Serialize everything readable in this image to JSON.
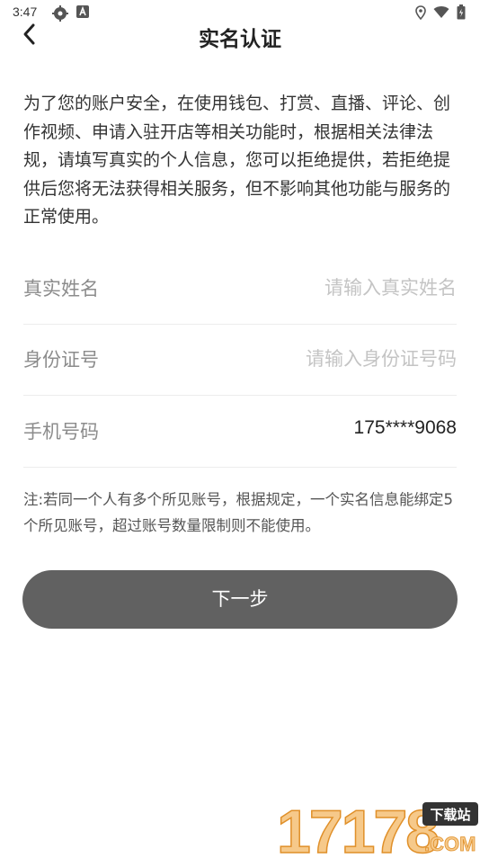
{
  "status_bar": {
    "time": "3:47",
    "left_icons": [
      "settings-gear-icon",
      "a-badge-icon"
    ],
    "right_icons": [
      "location-icon",
      "wifi-icon",
      "battery-icon"
    ]
  },
  "nav": {
    "back_icon": "back-chevron-icon",
    "title": "实名认证"
  },
  "intro": "为了您的账户安全，在使用钱包、打赏、直播、评论、创作视频、申请入驻开店等相关功能时，根据相关法律法规，请填写真实的个人信息，您可以拒绝提供，若拒绝提供后您将无法获得相关服务，但不影响其他功能与服务的正常使用。",
  "form": {
    "name": {
      "label": "真实姓名",
      "value": "",
      "placeholder": "请输入真实姓名"
    },
    "id_number": {
      "label": "身份证号",
      "value": "",
      "placeholder": "请输入身份证号码"
    },
    "phone": {
      "label": "手机号码",
      "value": "175****9068"
    }
  },
  "note": "注:若同一个人有多个所见账号，根据规定，一个实名信息能绑定5个所见账号，超过账号数量限制则不能使用。",
  "next_button": "下一步",
  "watermark": {
    "number": "17178",
    "tag": "下载站",
    "domain": ".COM"
  },
  "colors": {
    "button_bg": "#616161",
    "label": "#8c8c8c",
    "placeholder": "#c4c4c4",
    "watermark_orange": "#f0a23c"
  }
}
